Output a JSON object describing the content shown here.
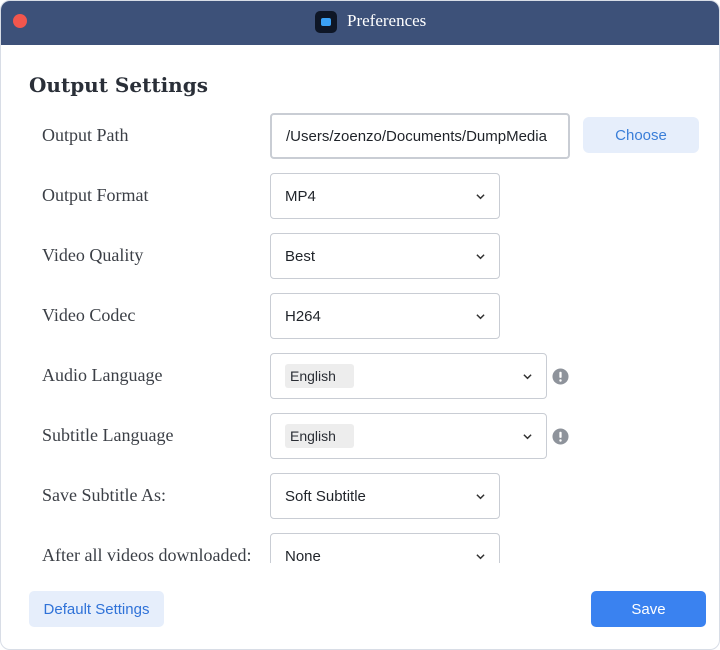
{
  "window": {
    "title": "Preferences",
    "app_icon": "dumpmedia-app-icon"
  },
  "section": {
    "title": "Output Settings"
  },
  "rows": {
    "output_path": {
      "label": "Output Path",
      "value": "/Users/zoenzo/Documents/DumpMedia",
      "button": "Choose"
    },
    "output_format": {
      "label": "Output Format",
      "value": "MP4"
    },
    "video_quality": {
      "label": "Video Quality",
      "value": "Best"
    },
    "video_codec": {
      "label": "Video Codec",
      "value": "H264"
    },
    "audio_language": {
      "label": "Audio Language",
      "value": "English"
    },
    "subtitle_language": {
      "label": "Subtitle Language",
      "value": "English"
    },
    "save_subtitle_as": {
      "label": "Save Subtitle As:",
      "value": "Soft Subtitle"
    },
    "after_download": {
      "label": "After all videos downloaded:",
      "value": "None"
    }
  },
  "footer": {
    "default_label": "Default Settings",
    "save_label": "Save"
  },
  "colors": {
    "titlebar": "#3d5179",
    "accent": "#3a82f0",
    "close": "#f2564d"
  }
}
